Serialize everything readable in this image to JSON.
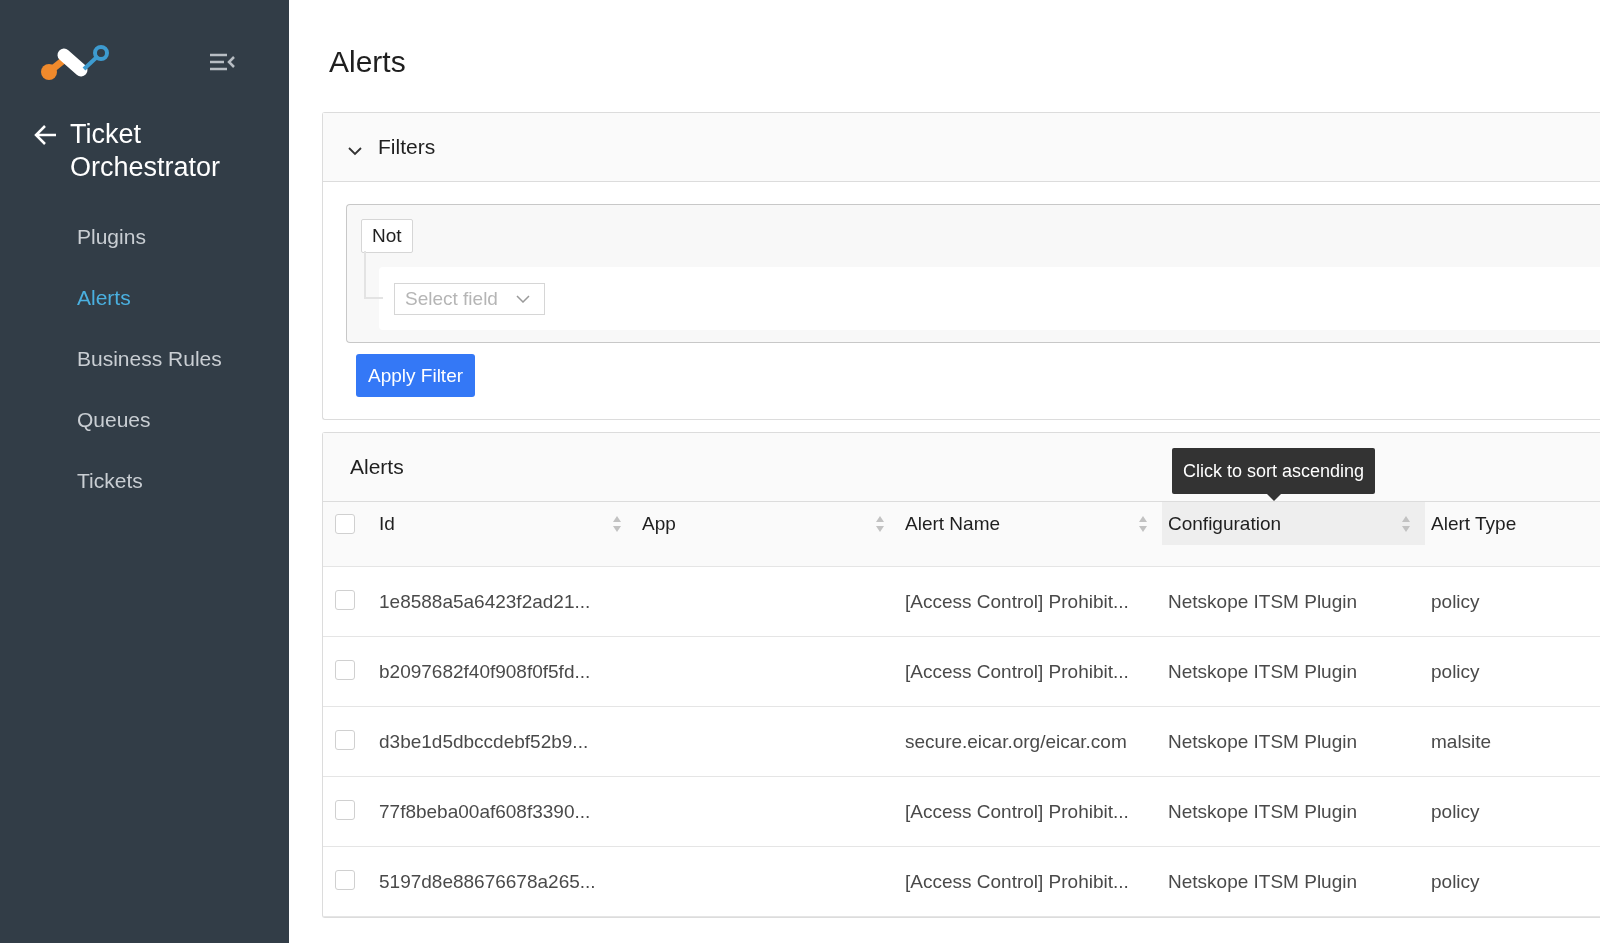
{
  "sidebar": {
    "back_title": "Ticket Orchestrator",
    "items": [
      {
        "label": "Plugins",
        "selected": false
      },
      {
        "label": "Alerts",
        "selected": true
      },
      {
        "label": "Business Rules",
        "selected": false
      },
      {
        "label": "Queues",
        "selected": false
      },
      {
        "label": "Tickets",
        "selected": false
      }
    ]
  },
  "page_title": "Alerts",
  "filters": {
    "title": "Filters",
    "expanded": true,
    "operator": "Not",
    "field_placeholder": "Select field",
    "apply_button": "Apply Filter"
  },
  "table": {
    "title": "Alerts",
    "tooltip": "Click to sort ascending",
    "header_checked": false,
    "columns": [
      {
        "label": "Id",
        "sortable": true,
        "highlighted": false
      },
      {
        "label": "App",
        "sortable": true,
        "highlighted": false
      },
      {
        "label": "Alert Name",
        "sortable": true,
        "highlighted": false
      },
      {
        "label": "Configuration",
        "sortable": true,
        "highlighted": true
      },
      {
        "label": "Alert Type",
        "sortable": false,
        "highlighted": false
      }
    ],
    "rows": [
      {
        "checked": false,
        "cells": [
          "1e8588a5a6423f2ad21...",
          "",
          "[Access Control] Prohibit...",
          "Netskope ITSM Plugin",
          "policy"
        ]
      },
      {
        "checked": false,
        "cells": [
          "b2097682f40f908f0f5fd...",
          "",
          "[Access Control] Prohibit...",
          "Netskope ITSM Plugin",
          "policy"
        ]
      },
      {
        "checked": false,
        "cells": [
          "d3be1d5dbccdebf52b9...",
          "",
          "secure.eicar.org/eicar.com",
          "Netskope ITSM Plugin",
          "malsite"
        ]
      },
      {
        "checked": false,
        "cells": [
          "77f8beba00af608f3390...",
          "",
          "[Access Control] Prohibit...",
          "Netskope ITSM Plugin",
          "policy"
        ]
      },
      {
        "checked": false,
        "cells": [
          "5197d8e88676678a265...",
          "",
          "[Access Control] Prohibit...",
          "Netskope ITSM Plugin",
          "policy"
        ]
      }
    ]
  }
}
